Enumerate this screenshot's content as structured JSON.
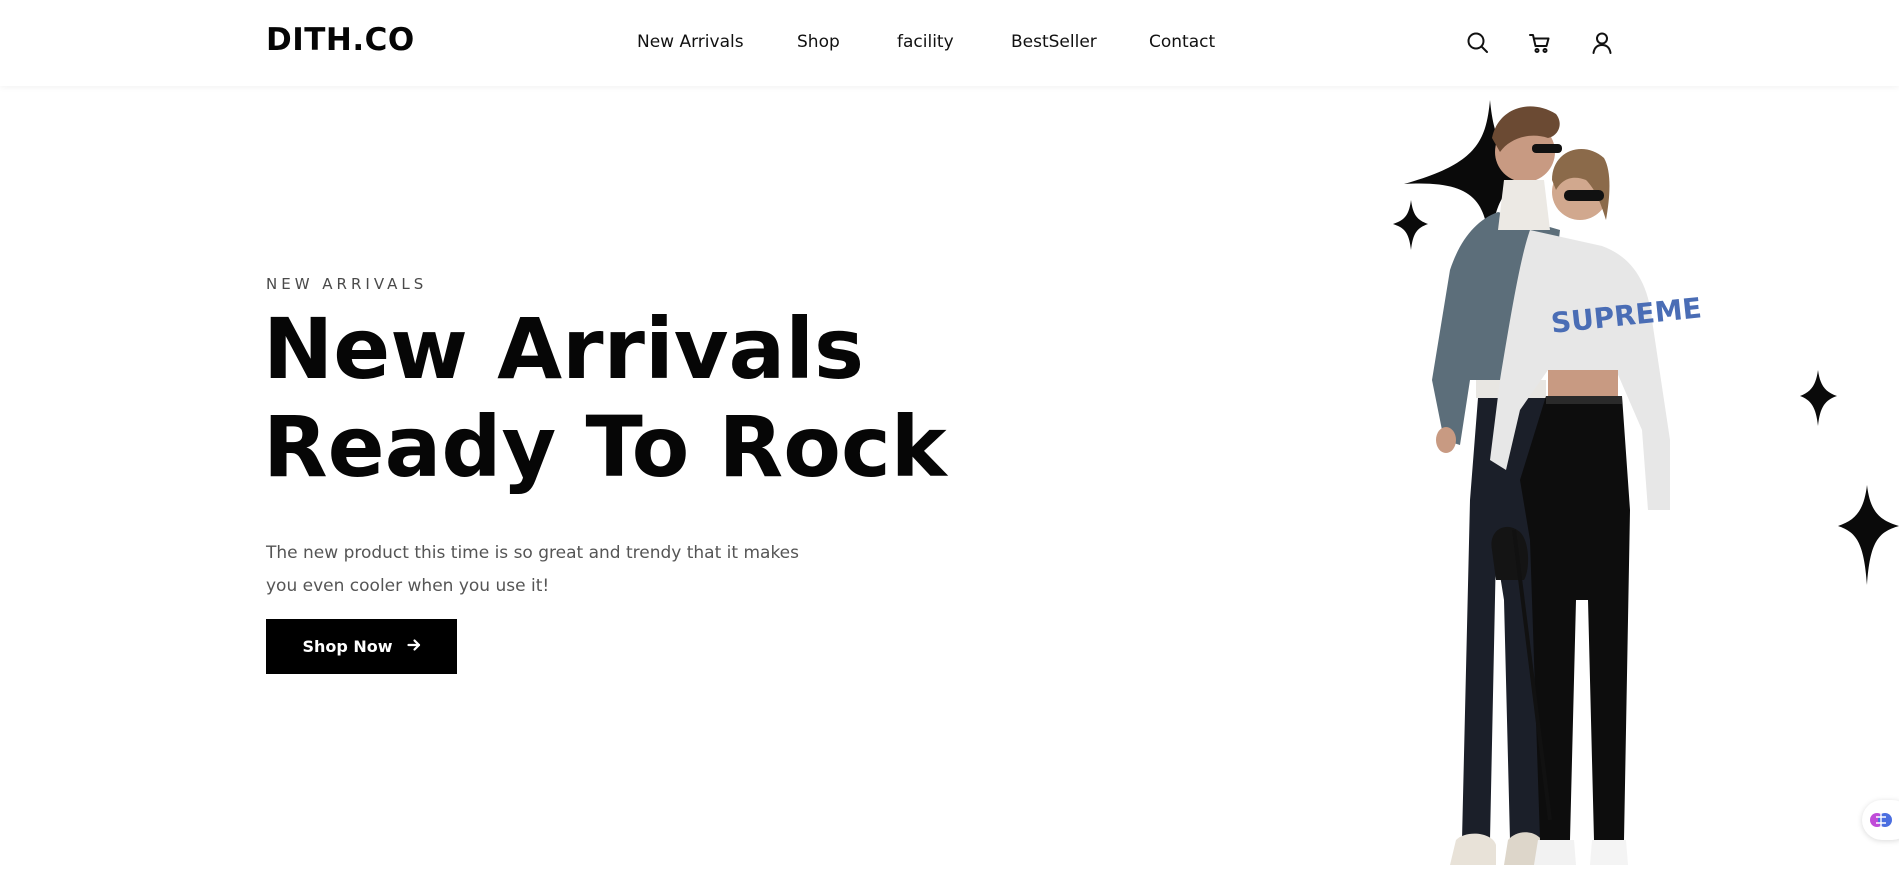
{
  "brand": {
    "logo": "DITH.CO"
  },
  "nav": {
    "items": [
      {
        "label": "New Arrivals"
      },
      {
        "label": "Shop"
      },
      {
        "label": "facility"
      },
      {
        "label": "BestSeller"
      },
      {
        "label": "Contact"
      }
    ]
  },
  "header_icons": [
    "search-icon",
    "cart-icon",
    "user-icon"
  ],
  "hero": {
    "eyebrow": "NEW ARRIVALS",
    "title_line1": "New Arrivals",
    "title_line2": "Ready To Rock",
    "description": "The new product this time is so great and trendy that it makes you even cooler when you use it!",
    "cta_label": "Shop Now"
  },
  "colors": {
    "text": "#0b0b0b",
    "muted": "#555555",
    "cta_bg": "#000000",
    "background": "#ffffff"
  }
}
